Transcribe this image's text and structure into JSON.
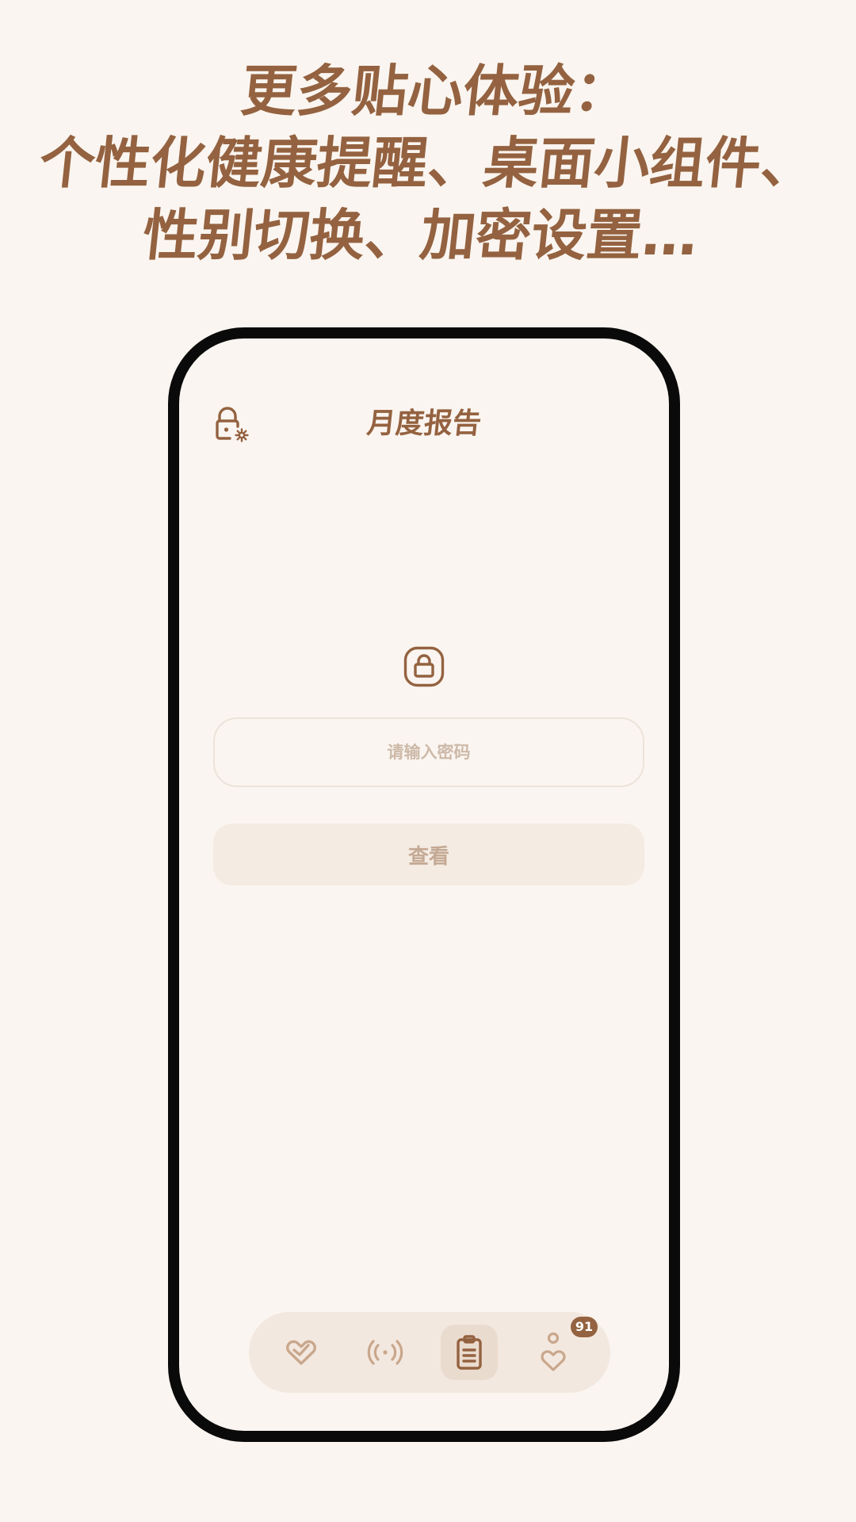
{
  "headline": {
    "line1": "更多贴心体验：",
    "line2": "个性化健康提醒、桌面小组件、",
    "line3": "性别切换、加密设置…"
  },
  "screen": {
    "title": "月度报告",
    "password": {
      "placeholder": "请输入密码",
      "value": ""
    },
    "view_button": "查看"
  },
  "tab_bar": {
    "tabs": [
      {
        "icon": "heart-check-icon",
        "active": false
      },
      {
        "icon": "broadcast-icon",
        "active": false
      },
      {
        "icon": "clipboard-icon",
        "active": true
      },
      {
        "icon": "person-heart-icon",
        "active": false
      }
    ],
    "badge": "91"
  },
  "colors": {
    "background": "#faf5f0",
    "accent": "#946240",
    "inactive_icon": "#c9a78c",
    "tab_bar": "#f3e8df",
    "phone_frame": "#0a0a0a"
  }
}
